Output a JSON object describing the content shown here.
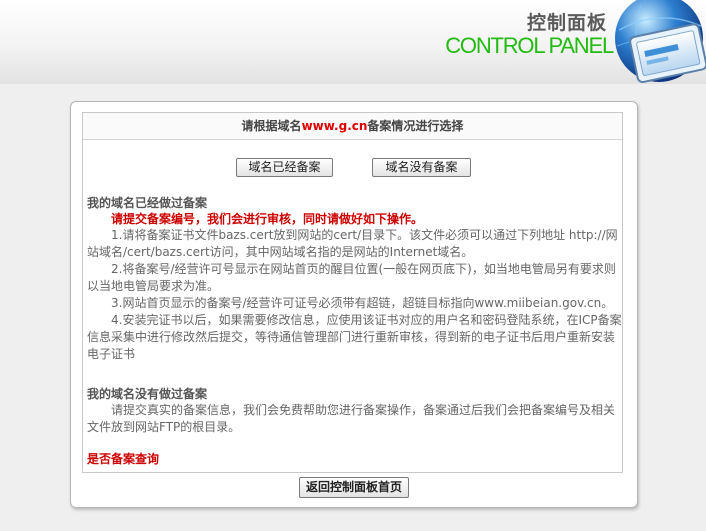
{
  "header": {
    "title_zh": "控制面板",
    "title_en": "CONTROL PANEL",
    "accent_color": "#22bb11",
    "icon": "globe-monitor-icon"
  },
  "panel": {
    "title_prefix": "请根据域名",
    "domain": "www.g.cn",
    "title_suffix": "备案情况进行选择",
    "buttons": {
      "registered": "域名已经备案",
      "unregistered": "域名没有备案"
    },
    "registered_section": {
      "title": "我的域名已经做过备案",
      "notice": "请提交备案编号，我们会进行审核，同时请做好如下操作。",
      "steps": [
        "1.请将备案证书文件bazs.cert放到网站的cert/目录下。该文件必须可以通过下列地址 http://网站域名/cert/bazs.cert访问，其中网站域名指的是网站的Internet域名。",
        "2.将备案号/经营许可号显示在网站首页的醒目位置(一般在网页底下)，如当地电管局另有要求则以当地电管局要求为准。",
        "3.网站首页显示的备案号/经营许可证号必须带有超链，超链目标指向www.miibeian.gov.cn。",
        "4.安装完证书以后，如果需要修改信息，应使用该证书对应的用户名和密码登陆系统，在ICP备案信息采集中进行修改然后提交，等待通信管理部门进行重新审核，得到新的电子证书后用户重新安装电子证书"
      ]
    },
    "unregistered_section": {
      "title": "我的域名没有做过备案",
      "text": "请提交真实的备案信息，我们会免费帮助您进行备案操作，备案通过后我们会把备案编号及相关文件放到网站FTP的根目录。"
    },
    "query_link": "是否备案查询",
    "back_button": "返回控制面板首页"
  }
}
